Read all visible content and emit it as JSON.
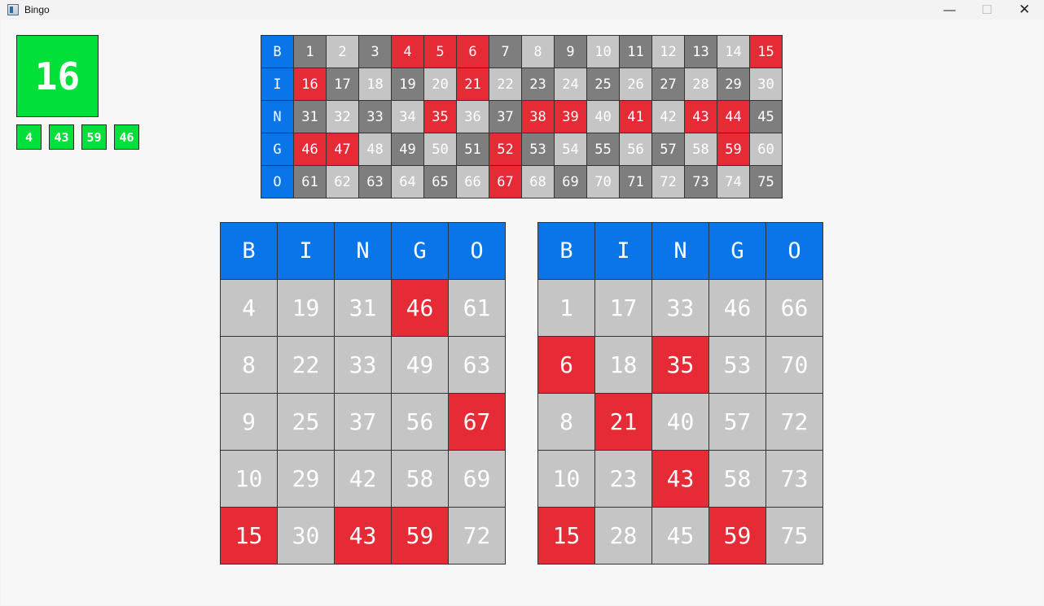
{
  "window": {
    "title": "Bingo",
    "min_symbol": "—",
    "max_symbol": "☐",
    "close_symbol": "✕"
  },
  "colors": {
    "header": "#0a75e8",
    "called": "#e62a36",
    "dark": "#7e7e7e",
    "light": "#c5c5c5",
    "current": "#00e038"
  },
  "current_ball": "16",
  "recent_balls": [
    "4",
    "43",
    "59",
    "46"
  ],
  "board": {
    "letters": [
      "B",
      "I",
      "N",
      "G",
      "O"
    ],
    "rows": [
      {
        "num": [
          "1",
          "2",
          "3",
          "4",
          "5",
          "6",
          "7",
          "8",
          "9",
          "10",
          "11",
          "12",
          "13",
          "14",
          "15"
        ],
        "state": [
          "d",
          "l",
          "d",
          "r",
          "r",
          "r",
          "d",
          "l",
          "d",
          "l",
          "d",
          "l",
          "d",
          "l",
          "r"
        ]
      },
      {
        "num": [
          "16",
          "17",
          "18",
          "19",
          "20",
          "21",
          "22",
          "23",
          "24",
          "25",
          "26",
          "27",
          "28",
          "29",
          "30"
        ],
        "state": [
          "r",
          "d",
          "l",
          "d",
          "l",
          "r",
          "l",
          "d",
          "l",
          "d",
          "l",
          "d",
          "l",
          "d",
          "l"
        ]
      },
      {
        "num": [
          "31",
          "32",
          "33",
          "34",
          "35",
          "36",
          "37",
          "38",
          "39",
          "40",
          "41",
          "42",
          "43",
          "44",
          "45"
        ],
        "state": [
          "d",
          "l",
          "d",
          "l",
          "r",
          "l",
          "d",
          "r",
          "r",
          "l",
          "r",
          "l",
          "r",
          "r",
          "d"
        ]
      },
      {
        "num": [
          "46",
          "47",
          "48",
          "49",
          "50",
          "51",
          "52",
          "53",
          "54",
          "55",
          "56",
          "57",
          "58",
          "59",
          "60"
        ],
        "state": [
          "r",
          "r",
          "l",
          "d",
          "l",
          "d",
          "r",
          "d",
          "l",
          "d",
          "l",
          "d",
          "l",
          "r",
          "l"
        ]
      },
      {
        "num": [
          "61",
          "62",
          "63",
          "64",
          "65",
          "66",
          "67",
          "68",
          "69",
          "70",
          "71",
          "72",
          "73",
          "74",
          "75"
        ],
        "state": [
          "d",
          "l",
          "d",
          "l",
          "d",
          "l",
          "r",
          "l",
          "d",
          "l",
          "d",
          "l",
          "d",
          "l",
          "d"
        ]
      }
    ]
  },
  "cards": [
    {
      "header": [
        "B",
        "I",
        "N",
        "G",
        "O"
      ],
      "rows": [
        {
          "num": [
            "4",
            "19",
            "31",
            "46",
            "61"
          ],
          "state": [
            "l",
            "l",
            "l",
            "r",
            "l"
          ]
        },
        {
          "num": [
            "8",
            "22",
            "33",
            "49",
            "63"
          ],
          "state": [
            "l",
            "l",
            "l",
            "l",
            "l"
          ]
        },
        {
          "num": [
            "9",
            "25",
            "37",
            "56",
            "67"
          ],
          "state": [
            "l",
            "l",
            "l",
            "l",
            "r"
          ]
        },
        {
          "num": [
            "10",
            "29",
            "42",
            "58",
            "69"
          ],
          "state": [
            "l",
            "l",
            "l",
            "l",
            "l"
          ]
        },
        {
          "num": [
            "15",
            "30",
            "43",
            "59",
            "72"
          ],
          "state": [
            "r",
            "l",
            "r",
            "r",
            "l"
          ]
        }
      ]
    },
    {
      "header": [
        "B",
        "I",
        "N",
        "G",
        "O"
      ],
      "rows": [
        {
          "num": [
            "1",
            "17",
            "33",
            "46",
            "66"
          ],
          "state": [
            "l",
            "l",
            "l",
            "l",
            "l"
          ]
        },
        {
          "num": [
            "6",
            "18",
            "35",
            "53",
            "70"
          ],
          "state": [
            "r",
            "l",
            "r",
            "l",
            "l"
          ]
        },
        {
          "num": [
            "8",
            "21",
            "40",
            "57",
            "72"
          ],
          "state": [
            "l",
            "r",
            "l",
            "l",
            "l"
          ]
        },
        {
          "num": [
            "10",
            "23",
            "43",
            "58",
            "73"
          ],
          "state": [
            "l",
            "l",
            "r",
            "l",
            "l"
          ]
        },
        {
          "num": [
            "15",
            "28",
            "45",
            "59",
            "75"
          ],
          "state": [
            "r",
            "l",
            "l",
            "r",
            "l"
          ]
        }
      ]
    }
  ]
}
